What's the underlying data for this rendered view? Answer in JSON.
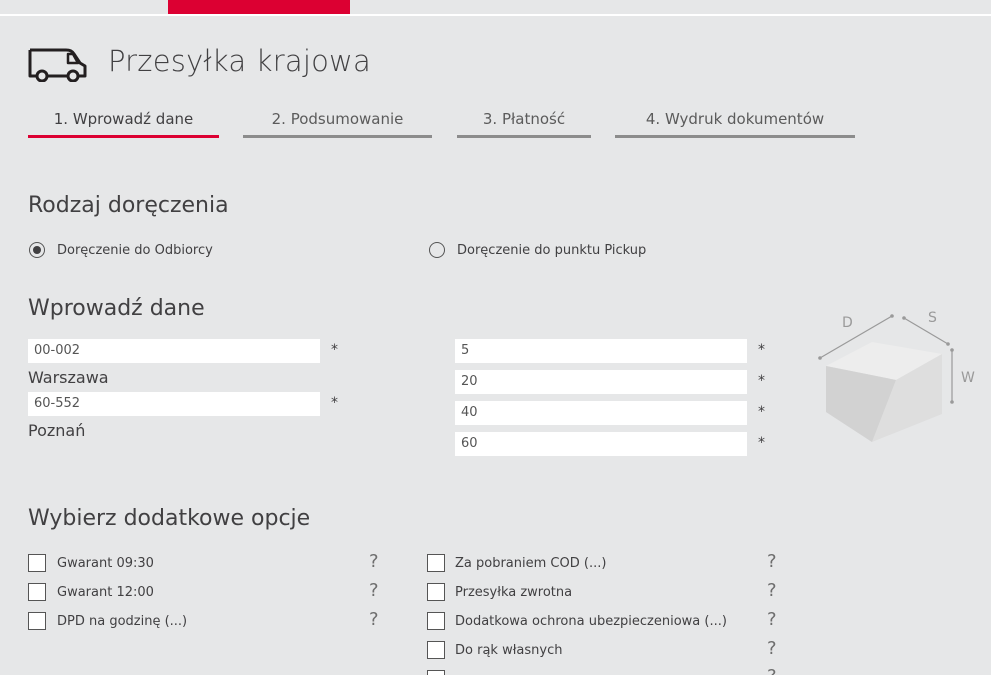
{
  "header": {
    "title": "Przesyłka krajowa",
    "truck_icon": "truck-icon"
  },
  "steps": [
    {
      "label": "1. Wprowadź dane",
      "active": true
    },
    {
      "label": "2. Podsumowanie",
      "active": false
    },
    {
      "label": "3. Płatność",
      "active": false
    },
    {
      "label": "4. Wydruk dokumentów",
      "active": false
    }
  ],
  "delivery": {
    "heading": "Rodzaj doręczenia",
    "options": [
      {
        "label": "Doręczenie do Odbiorcy",
        "selected": true
      },
      {
        "label": "Doręczenie do punktu Pickup",
        "selected": false
      }
    ]
  },
  "data": {
    "heading": "Wprowadź dane",
    "from_postcode": "00-002",
    "from_city": "Warszawa",
    "to_postcode": "60-552",
    "to_city": "Poznań",
    "required_mark": "*",
    "weight": "5",
    "length": "20",
    "width": "40",
    "height": "60"
  },
  "box": {
    "label_d": "D",
    "label_s": "S",
    "label_w": "W"
  },
  "options": {
    "heading": "Wybierz dodatkowe opcje",
    "help": "?",
    "left": [
      "Gwarant 09:30",
      "Gwarant 12:00",
      "DPD na godzinę (...)"
    ],
    "right": [
      "Za pobraniem COD (...)",
      "Przesyłka zwrotna",
      "Dodatkowa ochrona ubezpieczeniowa (...)",
      "Do rąk własnych",
      ""
    ]
  },
  "colors": {
    "accent": "#dc0032",
    "background": "#e6e7e8",
    "text": "#414042"
  }
}
